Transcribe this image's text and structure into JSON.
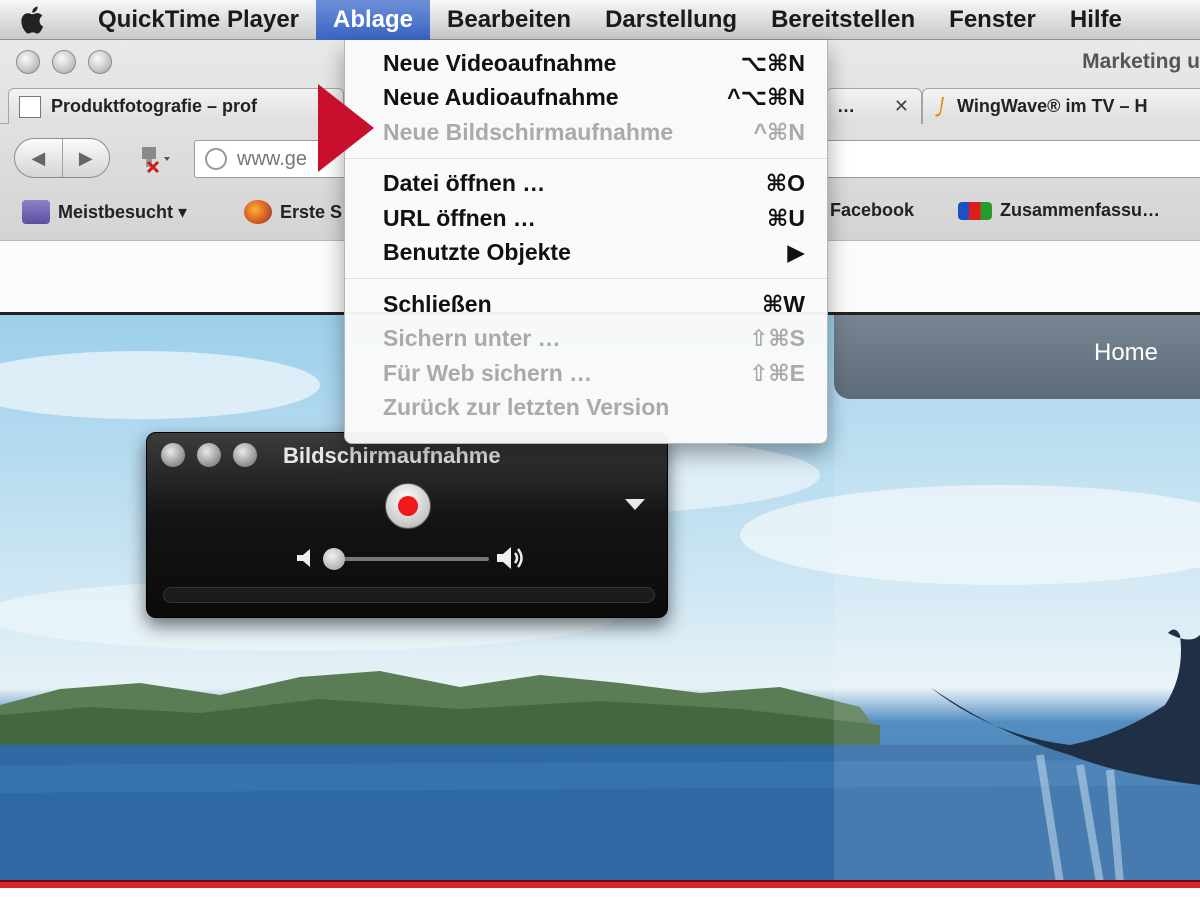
{
  "menubar": {
    "app_name": "QuickTime Player",
    "items": [
      "Ablage",
      "Bearbeiten",
      "Darstellung",
      "Bereitstellen",
      "Fenster",
      "Hilfe"
    ]
  },
  "browser": {
    "window_title": "Marketing u",
    "tabs": [
      {
        "label": "Produktfotografie – prof"
      },
      {
        "label": "…"
      },
      {
        "label": "WingWave® im TV – H"
      }
    ],
    "url": "www.ge",
    "bookmarks": [
      {
        "label": "Meistbesucht ▾"
      },
      {
        "label": "Erste S"
      },
      {
        "label": "Facebook"
      },
      {
        "label": "Zusammenfassu…"
      }
    ]
  },
  "page": {
    "nav_home": "Home"
  },
  "recorder": {
    "title": "Bildschirmaufnahme"
  },
  "dropdown": {
    "groups": [
      [
        {
          "label": "Neue Videoaufnahme",
          "shortcut": "⌥⌘N",
          "disabled": false
        },
        {
          "label": "Neue Audioaufnahme",
          "shortcut": "^⌥⌘N",
          "disabled": false
        },
        {
          "label": "Neue Bildschirmaufnahme",
          "shortcut": "^⌘N",
          "disabled": true
        }
      ],
      [
        {
          "label": "Datei öffnen …",
          "shortcut": "⌘O",
          "disabled": false
        },
        {
          "label": "URL öffnen …",
          "shortcut": "⌘U",
          "disabled": false
        },
        {
          "label": "Benutzte Objekte",
          "shortcut": "▶",
          "disabled": false
        }
      ],
      [
        {
          "label": "Schließen",
          "shortcut": "⌘W",
          "disabled": false
        },
        {
          "label": "Sichern unter …",
          "shortcut": "⇧⌘S",
          "disabled": true
        },
        {
          "label": "Für Web sichern …",
          "shortcut": "⇧⌘E",
          "disabled": true
        },
        {
          "label": "Zurück zur letzten Version",
          "shortcut": "",
          "disabled": true
        }
      ]
    ]
  },
  "colors": {
    "menu_highlight": "#3a64c4",
    "arrow_red": "#c8102e",
    "record_red": "#f01818",
    "bottom_stripe": "#d9232d"
  }
}
